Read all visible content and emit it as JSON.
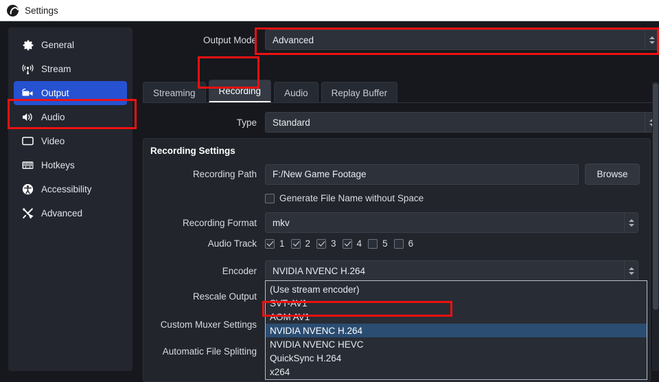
{
  "window": {
    "title": "Settings",
    "logo_icon": "obs-logo-icon"
  },
  "sidebar": {
    "items": [
      {
        "label": "General",
        "icon": "gear-icon",
        "selected": false
      },
      {
        "label": "Stream",
        "icon": "broadcast-icon",
        "selected": false
      },
      {
        "label": "Output",
        "icon": "video-camera-icon",
        "selected": true
      },
      {
        "label": "Audio",
        "icon": "speaker-icon",
        "selected": false
      },
      {
        "label": "Video",
        "icon": "monitor-icon",
        "selected": false
      },
      {
        "label": "Hotkeys",
        "icon": "keyboard-icon",
        "selected": false
      },
      {
        "label": "Accessibility",
        "icon": "accessibility-icon",
        "selected": false
      },
      {
        "label": "Advanced",
        "icon": "tools-icon",
        "selected": false
      }
    ]
  },
  "output_mode": {
    "label": "Output Mode",
    "value": "Advanced"
  },
  "tabs": [
    {
      "label": "Streaming",
      "active": false
    },
    {
      "label": "Recording",
      "active": true
    },
    {
      "label": "Audio",
      "active": false
    },
    {
      "label": "Replay Buffer",
      "active": false
    }
  ],
  "type_row": {
    "label": "Type",
    "value": "Standard"
  },
  "recording_settings": {
    "title": "Recording Settings",
    "recording_path": {
      "label": "Recording Path",
      "value": "F:/New Game Footage",
      "browse_label": "Browse"
    },
    "generate_no_space": {
      "label": "Generate File Name without Space",
      "checked": false
    },
    "recording_format": {
      "label": "Recording Format",
      "value": "mkv"
    },
    "audio_track": {
      "label": "Audio Track",
      "tracks": [
        {
          "number": "1",
          "checked": true
        },
        {
          "number": "2",
          "checked": true
        },
        {
          "number": "3",
          "checked": true
        },
        {
          "number": "4",
          "checked": true
        },
        {
          "number": "5",
          "checked": false
        },
        {
          "number": "6",
          "checked": false
        }
      ]
    },
    "encoder": {
      "label": "Encoder",
      "value": "NVIDIA NVENC H.264",
      "options": [
        {
          "label": "(Use stream encoder)",
          "selected": false
        },
        {
          "label": "SVT-AV1",
          "selected": false
        },
        {
          "label": "AOM AV1",
          "selected": false
        },
        {
          "label": "NVIDIA NVENC H.264",
          "selected": true
        },
        {
          "label": "NVIDIA NVENC HEVC",
          "selected": false
        },
        {
          "label": "QuickSync H.264",
          "selected": false
        },
        {
          "label": "x264",
          "selected": false
        }
      ]
    },
    "rescale_output": {
      "label": "Rescale Output",
      "checked": false
    },
    "custom_muxer_settings": {
      "label": "Custom Muxer Settings"
    },
    "automatic_file_splitting": {
      "label": "Automatic File Splitting",
      "checked": false
    }
  },
  "colors": {
    "accent_selected": "#2651d1",
    "annotation": "#ee1111",
    "popup_highlight": "#2b4d72",
    "panel_bg": "#23262e",
    "window_bg": "#16181d"
  }
}
